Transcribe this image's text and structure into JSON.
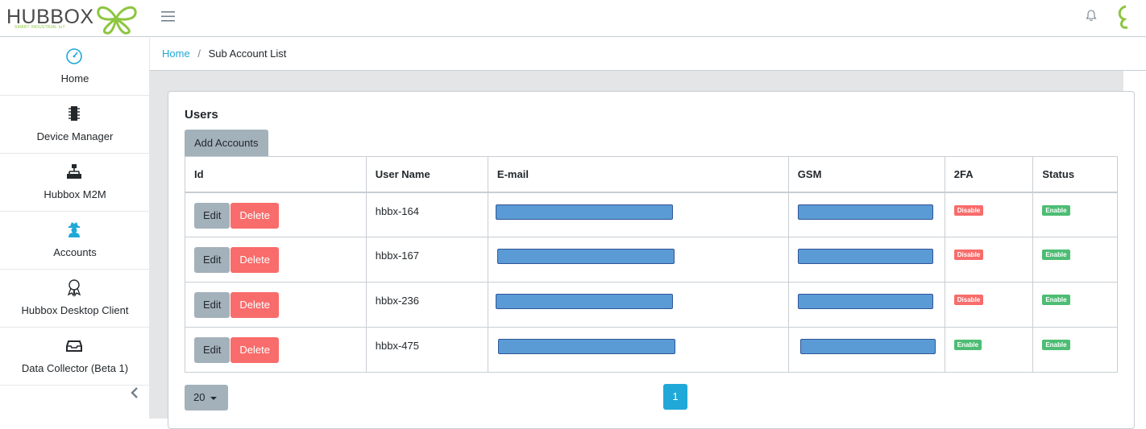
{
  "brand": {
    "name": "HUBBOX",
    "tagline": "SMART INDUSTRIAL IoT"
  },
  "header": {
    "menu_icon": "hamburger-icon",
    "bell_icon": "bell-icon"
  },
  "sidebar": {
    "items": [
      {
        "label": "Home",
        "icon": "speedometer-icon"
      },
      {
        "label": "Device Manager",
        "icon": "chip-icon"
      },
      {
        "label": "Hubbox M2M",
        "icon": "sitemap-icon"
      },
      {
        "label": "Accounts",
        "icon": "user-secret-icon"
      },
      {
        "label": "Hubbox Desktop Client",
        "icon": "badge-icon"
      },
      {
        "label": "Data Collector (Beta 1)",
        "icon": "inbox-icon"
      }
    ]
  },
  "breadcrumb": {
    "home": "Home",
    "separator": "/",
    "current": "Sub Account List"
  },
  "card": {
    "title": "Users",
    "add_button": "Add Accounts"
  },
  "table": {
    "headers": [
      "Id",
      "User Name",
      "E-mail",
      "GSM",
      "2FA",
      "Status"
    ],
    "edit_label": "Edit",
    "delete_label": "Delete",
    "rows": [
      {
        "username": "hbbx-164",
        "twofa": "Disable",
        "status": "Enable"
      },
      {
        "username": "hbbx-167",
        "twofa": "Disable",
        "status": "Enable"
      },
      {
        "username": "hbbx-236",
        "twofa": "Disable",
        "status": "Enable"
      },
      {
        "username": "hbbx-475",
        "twofa": "Enable",
        "status": "Enable"
      }
    ]
  },
  "pagination": {
    "page_size": "20",
    "current_page": "1"
  },
  "colors": {
    "primary": "#20a8d8",
    "danger": "#f86c6b",
    "success": "#4dbd74",
    "secondary": "#a3b1bb",
    "brand_green": "#8dc63f"
  }
}
